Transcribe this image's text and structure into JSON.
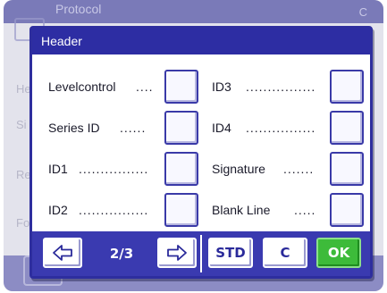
{
  "background": {
    "title": "Protocol",
    "corner_text": "C",
    "rows": [
      "He",
      "Si",
      "Re",
      "Fo"
    ]
  },
  "dialog": {
    "title": "Header",
    "items": [
      {
        "label": "Levelcontrol",
        "dots": "....",
        "checked": false
      },
      {
        "label": "ID3",
        "dots": "................",
        "checked": false
      },
      {
        "label": "Series ID",
        "dots": "......",
        "checked": false
      },
      {
        "label": "ID4",
        "dots": "................",
        "checked": false
      },
      {
        "label": "ID1",
        "dots": "................",
        "checked": false
      },
      {
        "label": "Signature",
        "dots": ".......",
        "checked": false
      },
      {
        "label": "ID2",
        "dots": "................",
        "checked": false
      },
      {
        "label": "Blank Line",
        "dots": ".....",
        "checked": false
      }
    ]
  },
  "footer": {
    "page_indicator": "2/3",
    "std_label": "STD",
    "c_label": "C",
    "ok_label": "OK",
    "prev_icon": "arrow-left-icon",
    "next_icon": "arrow-right-icon"
  },
  "colors": {
    "dialog_header": "#2d2da3",
    "footer": "#3a3ab0",
    "ok_button": "#3dbb3a"
  }
}
